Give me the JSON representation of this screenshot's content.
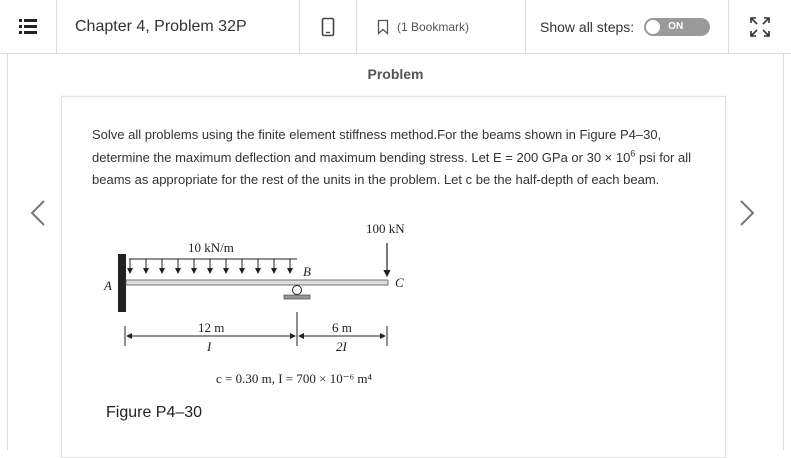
{
  "header": {
    "title": "Chapter 4, Problem 32P",
    "bookmark_label": "(1 Bookmark)",
    "show_steps_label": "Show all steps:",
    "toggle_label": "ON"
  },
  "main": {
    "heading": "Problem",
    "problem_text_1": "Solve all problems using the finite element stiffness method.For the beams shown in Figure P4–30, determine the maximum deflection and maximum bending stress. Let E = 200 GPa or 30 × 10",
    "problem_text_sup": "6",
    "problem_text_2": " psi for all beams as appropriate for the rest of the units in the problem. Let c be the half-depth of each beam.",
    "figure": {
      "load_point": "100 kN",
      "load_distributed": "10 kN/m",
      "label_a": "A",
      "label_b": "B",
      "label_c": "C",
      "span1_length": "12 m",
      "span1_inertia": "I",
      "span2_length": "6 m",
      "span2_inertia": "2I",
      "section_props": "c = 0.30 m, I = 700 × 10⁻⁶ m⁴"
    },
    "figure_caption": "Figure P4–30"
  },
  "icons": {
    "menu": "menu-icon",
    "phone": "phone-icon",
    "bookmark": "bookmark-icon",
    "expand": "expand-icon",
    "prev": "chevron-left-icon",
    "next": "chevron-right-icon"
  }
}
